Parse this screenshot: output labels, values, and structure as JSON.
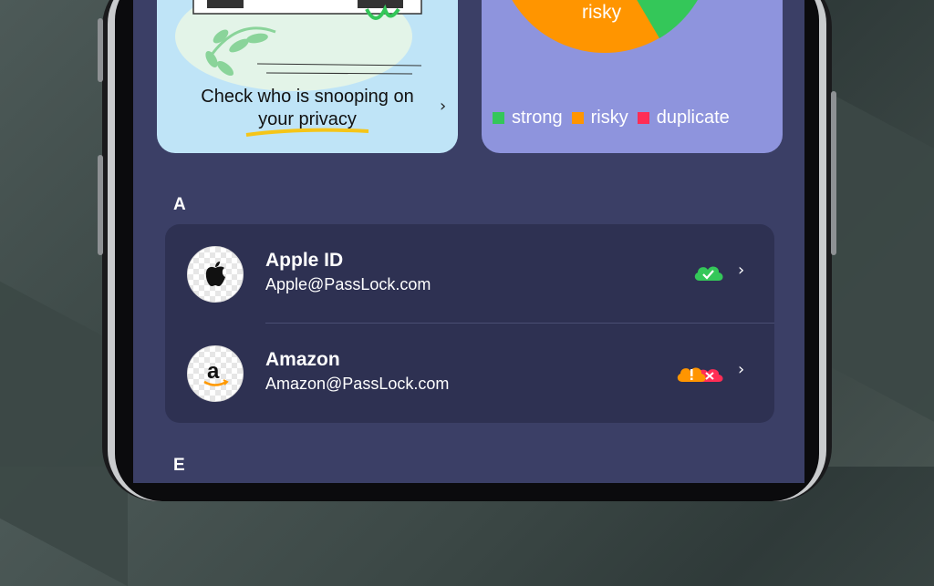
{
  "privacy_card": {
    "text_line1": "Check who is snooping on",
    "text_line2": "your privacy",
    "chevron": "›"
  },
  "password_chart": {
    "slice_label": "risky",
    "legend": [
      {
        "label": "strong",
        "color": "#34c759"
      },
      {
        "label": "risky",
        "color": "#ff9500"
      },
      {
        "label": "duplicate",
        "color": "#ff2d55"
      }
    ]
  },
  "sections": [
    {
      "letter": "A",
      "items": [
        {
          "title": "Apple ID",
          "subtitle": "Apple@PassLock.com",
          "status": "strong",
          "status_icon": "cloud-check-icon",
          "chevron": "›"
        },
        {
          "title": "Amazon",
          "subtitle": "Amazon@PassLock.com",
          "status": "risky-duplicate",
          "status_icon": "cloud-warning-icon",
          "chevron": "›"
        }
      ]
    },
    {
      "letter": "E"
    }
  ],
  "colors": {
    "screen_bg": "#3b3f66",
    "card_bg": "#2e3152",
    "privacy_card_bg": "#bfe4f7",
    "pie_card_bg": "#8e94dd",
    "strong": "#34c759",
    "risky": "#ff9500",
    "duplicate": "#ff2d55"
  }
}
